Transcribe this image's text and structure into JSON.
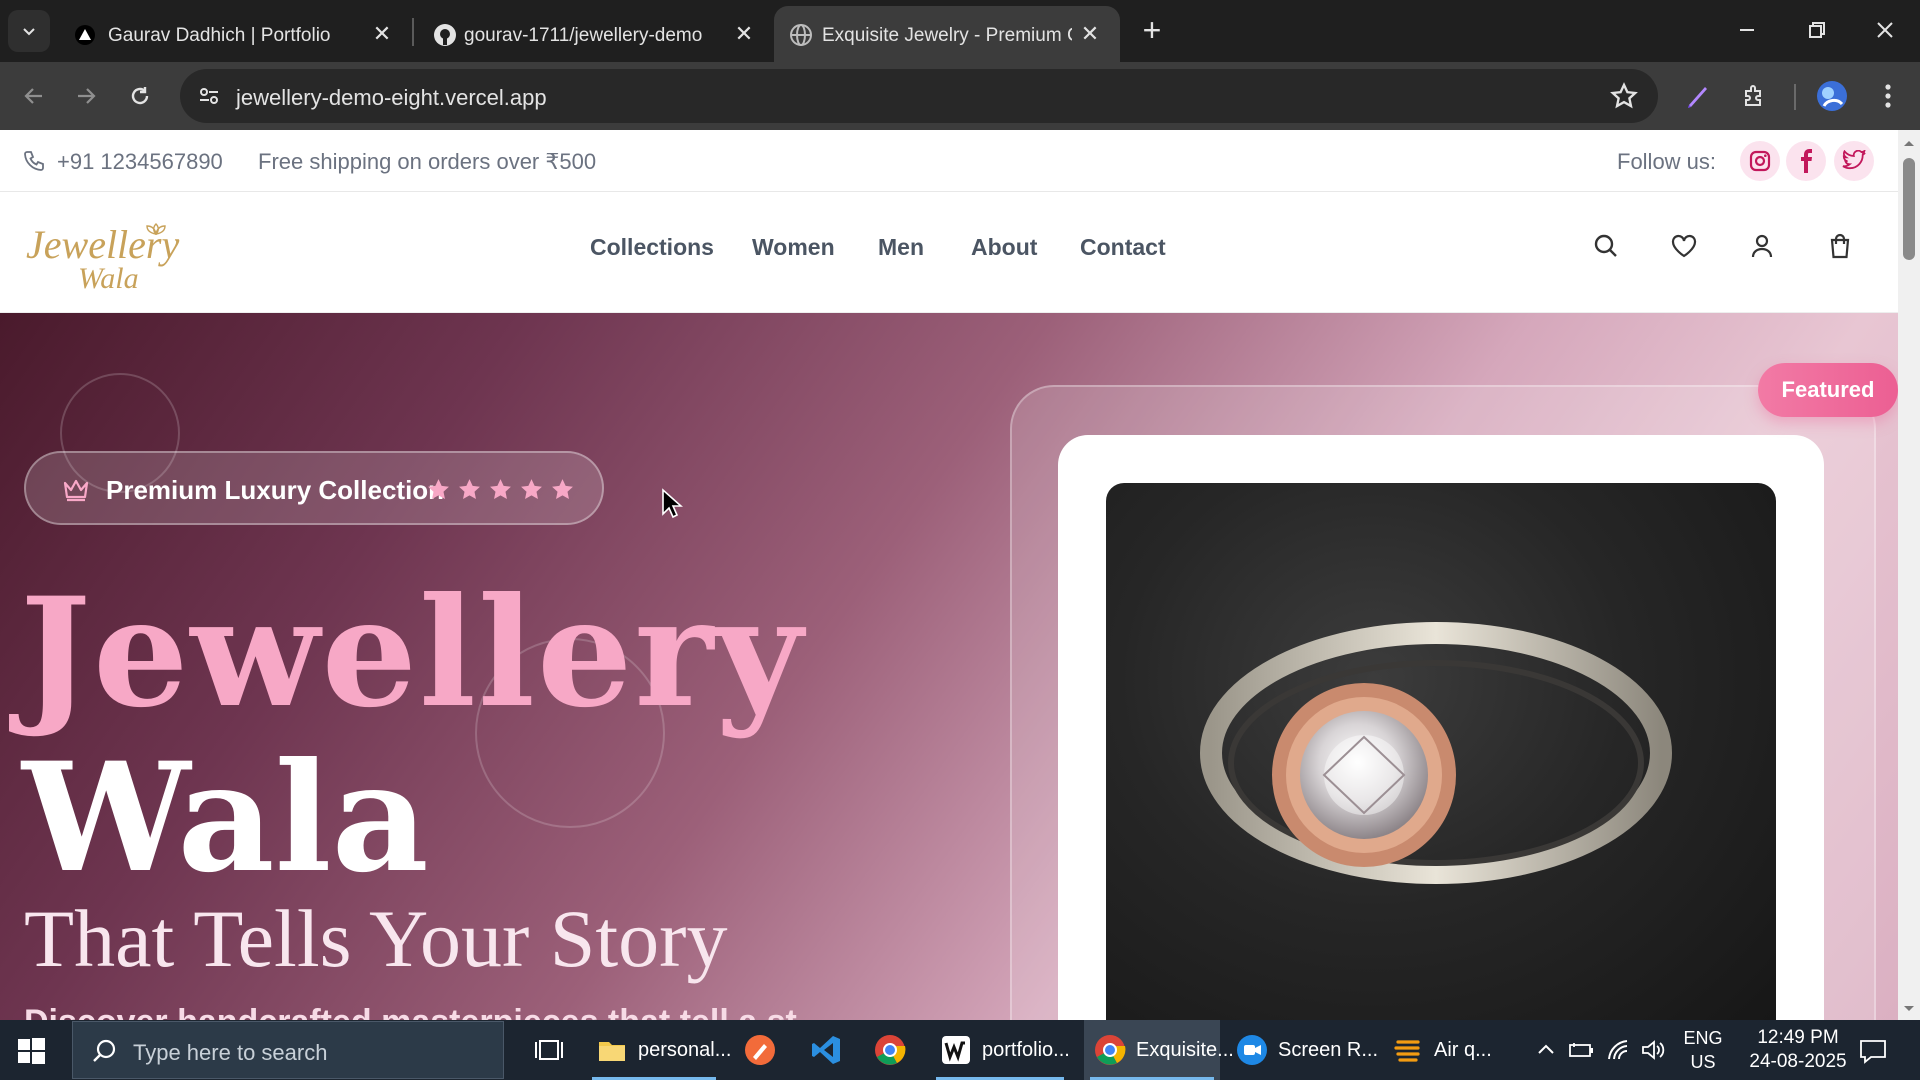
{
  "browser": {
    "tabs": [
      {
        "title": "Gaurav Dadhich | Portfolio",
        "active": false
      },
      {
        "title": "gourav-1711/jewellery-demo",
        "active": false
      },
      {
        "title": "Exquisite Jewelry - Premium Co",
        "active": true
      }
    ],
    "url": "jewellery-demo-eight.vercel.app"
  },
  "topbar": {
    "phone": "+91 1234567890",
    "shipping": "Free shipping on orders over ₹500",
    "follow_label": "Follow us:"
  },
  "navbar": {
    "logo": {
      "line1": "Jewellery",
      "line2": "Wala"
    },
    "links": [
      "Collections",
      "Women",
      "Men",
      "About",
      "Contact"
    ]
  },
  "hero": {
    "badge": "Premium Luxury Collection",
    "rating": 5,
    "headline1": "Jewellery",
    "headline2": "Wala",
    "headline3": "That Tells Your Story",
    "subtext_partial": "Discover handcrafted masterpieces that tell a st",
    "featured_label": "Featured"
  },
  "colors": {
    "brand_pink": "#f7a8c6",
    "accent_pink": "#ec5f93",
    "hero_dark": "#4a1a2c",
    "logo_gold": "#c8a25a"
  },
  "taskbar": {
    "search_placeholder": "Type here to search",
    "apps": [
      {
        "label": "personal...",
        "icon": "folder-icon"
      },
      {
        "label": "",
        "icon": "pen-app-icon"
      },
      {
        "label": "",
        "icon": "vscode-icon"
      },
      {
        "label": "",
        "icon": "chrome-icon"
      },
      {
        "label": "portfolio...",
        "icon": "w-app-icon"
      },
      {
        "label": "Exquisite...",
        "icon": "chrome-icon"
      },
      {
        "label": "Screen R...",
        "icon": "screen-recorder-icon"
      },
      {
        "label": "Air q...",
        "icon": "weather-icon"
      }
    ],
    "lang": "ENG",
    "region": "US",
    "time": "12:49 PM",
    "date": "24-08-2025"
  }
}
